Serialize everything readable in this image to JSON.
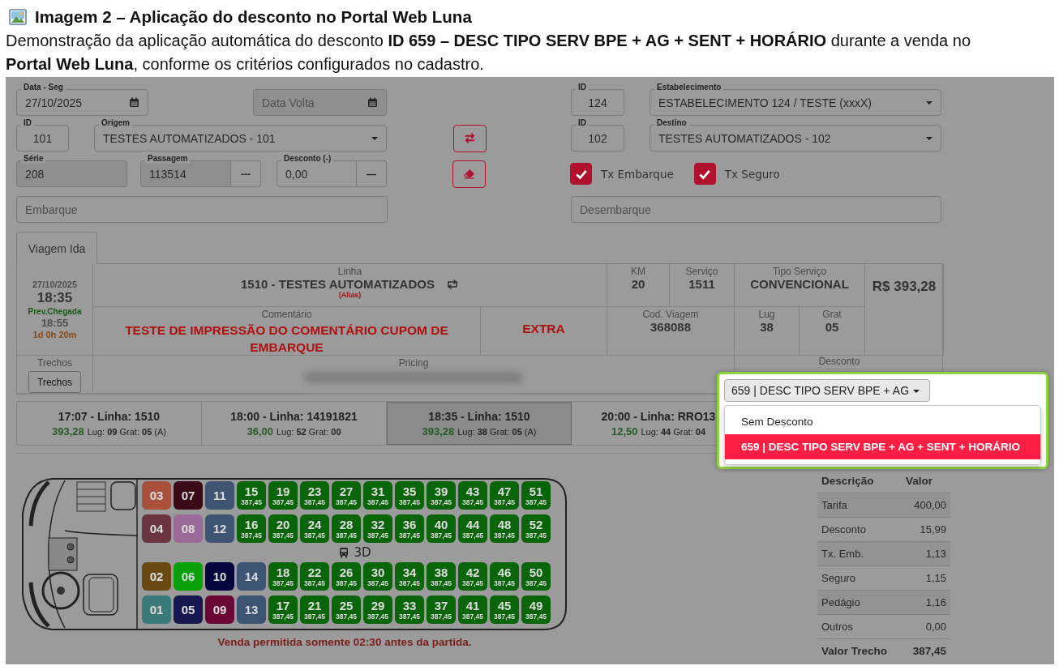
{
  "doc": {
    "title": "Imagem 2 – Aplicação do desconto no Portal Web Luna",
    "caption": "Demonstração da aplicação automática do desconto **ID 659 – DESC TIPO SERV BPE + AG + SENT + HORÁRIO** durante a venda no **Portal Web Luna**, conforme os critérios configurados no cadastro."
  },
  "form": {
    "date_outbound": {
      "label": "Data - Seg",
      "value": "27/10/2025"
    },
    "date_return": {
      "placeholder": "Data Volta"
    },
    "agency": {
      "id_label": "ID",
      "id": "124",
      "label": "Estabelecimento",
      "value": "ESTABELECIMENTO 124 / TESTE (xxxX)"
    },
    "origin": {
      "id_label": "ID",
      "id": "101",
      "label": "Origem",
      "value": "TESTES AUTOMATIZADOS - 101"
    },
    "destination": {
      "id_label": "ID",
      "id": "102",
      "label": "Destino",
      "value": "TESTES AUTOMATIZADOS - 102"
    },
    "series": {
      "label": "Série",
      "value": "208"
    },
    "ticket": {
      "label": "Passagem",
      "value": "113514",
      "button": "---"
    },
    "discount": {
      "label": "Desconto (-)",
      "value": "0,00",
      "button": "—"
    },
    "checkboxes": [
      {
        "label": "Tx Embarque",
        "checked": true
      },
      {
        "label": "Tx Seguro",
        "checked": true
      }
    ],
    "boarding": {
      "placeholder": "Embarque"
    },
    "alighting": {
      "placeholder": "Desembarque"
    }
  },
  "tabs": [
    {
      "label": "Viagem Ida",
      "selected": true
    }
  ],
  "trip": {
    "date": "27/10/2025",
    "time": "18:35",
    "arrival_label": "Prev.Chegada",
    "arrival_time": "18:55",
    "duration": "1d 0h 20m",
    "line_label": "Linha",
    "line": "1510 - TESTES AUTOMATIZADOS",
    "alias": "(Alias)",
    "km_label": "KM",
    "km": "20",
    "service_label": "Serviço",
    "service": "1511",
    "type_label": "Tipo Serviço",
    "type": "CONVENCIONAL",
    "price": "R$ 393,28",
    "comment_label": "Comentário",
    "comment": "TESTE DE IMPRESSÃO DO COMENTÁRIO CUPOM DE EMBARQUE",
    "extra": "EXTRA",
    "code_label": "Cod. Viagem",
    "code": "368088",
    "lug_label": "Lug",
    "lug": "38",
    "grat_label": "Grat",
    "grat": "05",
    "segments_label": "Trechos",
    "segments_button": "Trechos",
    "pricing_label": "Pricing",
    "discount_label": "Desconto"
  },
  "trip_options": [
    {
      "title": "17:07 - Linha: 1510",
      "price": "393,28",
      "details": "Lug: **09** Grat: **05** (A)",
      "selected": false
    },
    {
      "title": "18:00 - Linha: 14191821",
      "price": "36,00",
      "details": "Lug: **52** Grat: **00**",
      "selected": false
    },
    {
      "title": "18:35 - Linha: 1510",
      "price": "393,28",
      "details": "Lug: **38** Grat: **05** (A)",
      "selected": true
    },
    {
      "title": "20:00 - Linha: RRO13",
      "price": "12,50",
      "details": "Lug: **44** Grat: **04**",
      "selected": false
    }
  ],
  "discount_dropdown": {
    "value": "659 | DESC TIPO SERV BPE + AG",
    "options": [
      {
        "label": "Sem Desconto",
        "selected": false
      },
      {
        "label": "659 | DESC TIPO SERV BPE + AG + SENT + HORÁRIO",
        "selected": true
      }
    ]
  },
  "bus": {
    "label": "3D",
    "seat_rows": [
      [
        {
          "number": "03",
          "color": "#a8503c"
        },
        {
          "number": "07",
          "color": "#3a0a18"
        },
        {
          "number": "11",
          "color": "#3d5573"
        },
        {
          "number": "15",
          "price": "387,45",
          "color": "#0a650a"
        },
        {
          "number": "19",
          "price": "387,45",
          "color": "#0a650a"
        },
        {
          "number": "23",
          "price": "387,45",
          "color": "#0a650a"
        },
        {
          "number": "27",
          "price": "387,45",
          "color": "#0a650a"
        },
        {
          "number": "31",
          "price": "387,45",
          "color": "#0a650a"
        },
        {
          "number": "35",
          "price": "387,45",
          "color": "#0a650a"
        },
        {
          "number": "39",
          "price": "387,45",
          "color": "#0a650a"
        },
        {
          "number": "43",
          "price": "387,45",
          "color": "#0a650a"
        },
        {
          "number": "47",
          "price": "387,45",
          "color": "#0a650a"
        },
        {
          "number": "51",
          "price": "387,45",
          "color": "#0a650a"
        }
      ],
      [
        {
          "number": "04",
          "color": "#6a3440"
        },
        {
          "number": "08",
          "color": "#9a6a98"
        },
        {
          "number": "12",
          "color": "#3d5573"
        },
        {
          "number": "16",
          "price": "387,45",
          "color": "#0a650a"
        },
        {
          "number": "20",
          "price": "387,45",
          "color": "#0a650a"
        },
        {
          "number": "24",
          "price": "387,45",
          "color": "#0a650a"
        },
        {
          "number": "28",
          "price": "387,45",
          "color": "#0a650a"
        },
        {
          "number": "32",
          "price": "387,45",
          "color": "#0a650a"
        },
        {
          "number": "36",
          "price": "387,45",
          "color": "#0a650a"
        },
        {
          "number": "40",
          "price": "387,45",
          "color": "#0a650a"
        },
        {
          "number": "44",
          "price": "387,45",
          "color": "#0a650a"
        },
        {
          "number": "48",
          "price": "387,45",
          "color": "#0a650a"
        },
        {
          "number": "52",
          "price": "387,45",
          "color": "#0a650a"
        }
      ],
      [
        {
          "number": "02",
          "color": "#6a4a12"
        },
        {
          "number": "06",
          "color": "#0aa00a"
        },
        {
          "number": "10",
          "color": "#06063e"
        },
        {
          "number": "14",
          "color": "#3d5573"
        },
        {
          "number": "18",
          "price": "387,45",
          "color": "#0a650a"
        },
        {
          "number": "22",
          "price": "387,45",
          "color": "#0a650a"
        },
        {
          "number": "26",
          "price": "387,45",
          "color": "#0a650a"
        },
        {
          "number": "30",
          "price": "387,45",
          "color": "#0a650a"
        },
        {
          "number": "34",
          "price": "387,45",
          "color": "#0a650a"
        },
        {
          "number": "38",
          "price": "387,45",
          "color": "#0a650a"
        },
        {
          "number": "42",
          "price": "387,45",
          "color": "#0a650a"
        },
        {
          "number": "46",
          "price": "387,45",
          "color": "#0a650a"
        },
        {
          "number": "50",
          "price": "387,45",
          "color": "#0a650a"
        }
      ],
      [
        {
          "number": "01",
          "color": "#3a7a78"
        },
        {
          "number": "05",
          "color": "#16184e"
        },
        {
          "number": "09",
          "color": "#6a0838"
        },
        {
          "number": "13",
          "color": "#3d5573"
        },
        {
          "number": "17",
          "price": "387,45",
          "color": "#0a650a"
        },
        {
          "number": "21",
          "price": "387,45",
          "color": "#0a650a"
        },
        {
          "number": "25",
          "price": "387,45",
          "color": "#0a650a"
        },
        {
          "number": "29",
          "price": "387,45",
          "color": "#0a650a"
        },
        {
          "number": "33",
          "price": "387,45",
          "color": "#0a650a"
        },
        {
          "number": "37",
          "price": "387,45",
          "color": "#0a650a"
        },
        {
          "number": "41",
          "price": "387,45",
          "color": "#0a650a"
        },
        {
          "number": "45",
          "price": "387,45",
          "color": "#0a650a"
        },
        {
          "number": "49",
          "price": "387,45",
          "color": "#0a650a"
        }
      ]
    ]
  },
  "notice": "Venda permitida somente 02:30 antes da partida.",
  "fees": {
    "columns": [
      "Descrição",
      "Valor"
    ],
    "rows": [
      {
        "label": "Tarifa",
        "value": "400,00"
      },
      {
        "label": "Desconto",
        "value": "15,99"
      },
      {
        "label": "Tx. Emb.",
        "value": "1,13"
      },
      {
        "label": "Seguro",
        "value": "1,15"
      },
      {
        "label": "Pedágio",
        "value": "1,16"
      },
      {
        "label": "Outros",
        "value": "0,00"
      }
    ],
    "total": {
      "label": "Valor Trecho",
      "value": "387,45"
    }
  }
}
